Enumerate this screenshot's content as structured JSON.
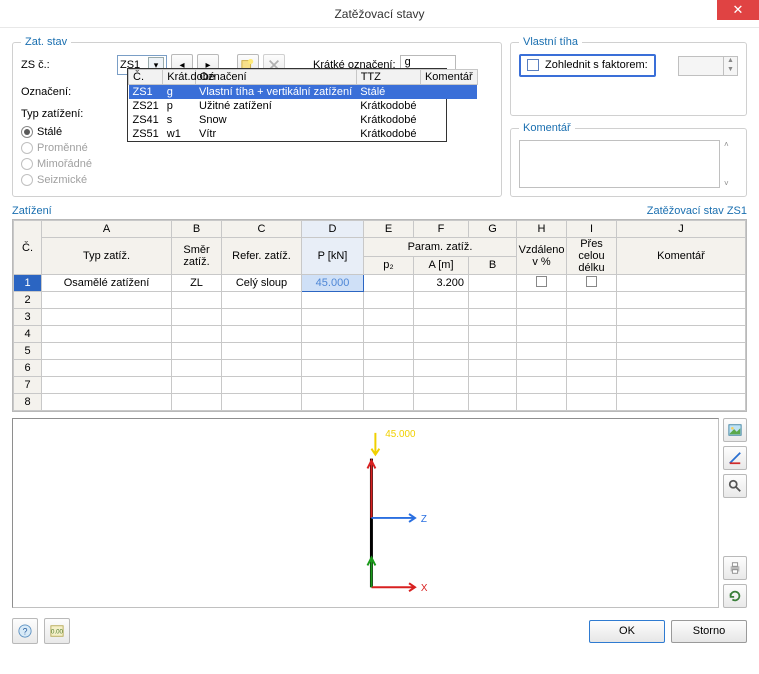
{
  "window": {
    "title": "Zatěžovací stavy"
  },
  "zat_stav": {
    "legend": "Zat. stav",
    "zs_c_label": "ZS č.:",
    "zs_c_value": "ZS1",
    "oznaceni_label": "Označení:",
    "typ_label": "Typ zatížení:",
    "kratke_label": "Krátké označení:",
    "kratke_value": "g",
    "radios": {
      "stale": "Stálé",
      "promenne": "Proměnné",
      "mimoradne": "Mimořádné",
      "seizmicke": "Seizmické"
    }
  },
  "dropdown": {
    "headers": {
      "c": "Č.",
      "kr": "Krát.",
      "ozn": "Označení",
      "ttz": "TTZ",
      "kom": "Komentář",
      "dobe": "dobé"
    },
    "rows": [
      {
        "c": "ZS1",
        "kr": "g",
        "ozn": "Vlastní tíha + vertikální zatížení",
        "ttz": "Stálé"
      },
      {
        "c": "ZS21",
        "kr": "p",
        "ozn": "Užitné zatížení",
        "ttz": "Krátkodobé"
      },
      {
        "c": "ZS41",
        "kr": "s",
        "ozn": "Snow",
        "ttz": "Krátkodobé"
      },
      {
        "c": "ZS51",
        "kr": "w1",
        "ozn": "Vítr",
        "ttz": "Krátkodobé"
      }
    ]
  },
  "vlastni_tiha": {
    "legend": "Vlastní tíha",
    "zohlednit": "Zohlednit s faktorem:"
  },
  "komentar": {
    "legend": "Komentář"
  },
  "zatizeni": {
    "legend": "Zatížení",
    "right": "Zatěžovací stav ZS1",
    "group_param": "Param. zatíž.",
    "cols": {
      "c": "Č.",
      "A": "A",
      "B": "B",
      "C": "C",
      "D": "D",
      "E": "E",
      "F": "F",
      "G": "G",
      "H": "H",
      "I": "I",
      "J": "J",
      "typ": "Typ zatíž.",
      "smer": "Směr zatíž.",
      "refer": "Refer. zatíž.",
      "pkn": "P [kN]",
      "p2": "p₂",
      "am": "A [m]",
      "bcol": "B",
      "vzd": "Vzdáleno v %",
      "pres": "Přes celou délku",
      "kom": "Komentář"
    },
    "rows": [
      {
        "n": "1",
        "typ": "Osamělé zatížení",
        "smer": "ZL",
        "refer": "Celý sloup",
        "pkn": "45.000",
        "p2": "",
        "am": "3.200",
        "b": ""
      },
      {
        "n": "2"
      },
      {
        "n": "3"
      },
      {
        "n": "4"
      },
      {
        "n": "5"
      },
      {
        "n": "6"
      },
      {
        "n": "7"
      },
      {
        "n": "8"
      }
    ]
  },
  "chart_data": {
    "type": "diagram",
    "title": "",
    "load_label": "45.000",
    "axes": {
      "x": "X",
      "z": "Z"
    },
    "description": "Column with vertical point load 45.000 at top; coordinate triad at base (X red horizontal, Z blue horizontal right, load arrow yellow downward at top, red vertical column)"
  },
  "buttons": {
    "ok": "OK",
    "storno": "Storno"
  }
}
